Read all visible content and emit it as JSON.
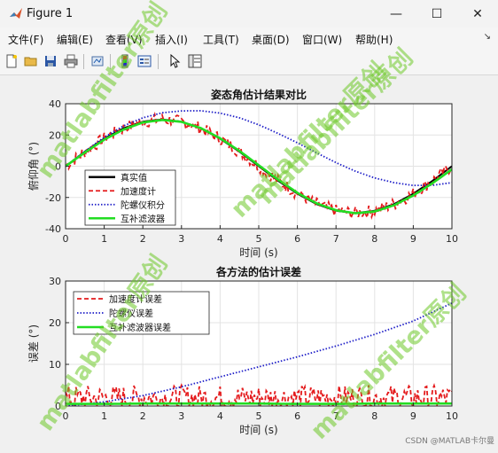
{
  "window": {
    "title": "Figure 1",
    "controls": {
      "minimize": "—",
      "maximize": "☐",
      "close": "✕"
    }
  },
  "menu": [
    "文件(F)",
    "编辑(E)",
    "查看(V)",
    "插入(I)",
    "工具(T)",
    "桌面(D)",
    "窗口(W)",
    "帮助(H)"
  ],
  "menu_arrow": "↘",
  "toolbar": [
    "new-file-icon",
    "open-folder-icon",
    "save-icon",
    "print-icon",
    "link-plot-icon",
    "insert-colorbar-icon",
    "insert-legend-icon",
    "edit-plot-cursor-icon",
    "property-inspector-icon"
  ],
  "colors": {
    "true": "#000000",
    "accel": "#e41a1c",
    "gyro": "#1f1fc8",
    "comp": "#22dd22"
  },
  "chart_data": [
    {
      "type": "line",
      "title": "姿态角估计结果对比",
      "xlabel": "时间 (s)",
      "ylabel": "俯仰角 (°)",
      "xlim": [
        0,
        10
      ],
      "ylim": [
        -40,
        40
      ],
      "xticks": [
        0,
        1,
        2,
        3,
        4,
        5,
        6,
        7,
        8,
        9,
        10
      ],
      "yticks": [
        -40,
        -20,
        0,
        20,
        40
      ],
      "grid": true,
      "legend": "bottom-left",
      "x": [
        0,
        0.5,
        1,
        1.5,
        2,
        2.5,
        3,
        3.5,
        4,
        4.5,
        5,
        5.5,
        6,
        6.5,
        7,
        7.5,
        8,
        8.5,
        9,
        9.5,
        10
      ],
      "series": [
        {
          "name": "真实值",
          "style": "solid",
          "values": [
            0,
            9.3,
            17.7,
            24.3,
            28.5,
            30,
            28.5,
            24.3,
            17.6,
            9.3,
            0,
            -9.3,
            -17.6,
            -24.3,
            -28.5,
            -30,
            -28.5,
            -24.3,
            -17.6,
            -9.3,
            0
          ]
        },
        {
          "name": "加速度计",
          "style": "dashed",
          "noisy": true,
          "noise": 4,
          "values": [
            0,
            9.3,
            17.7,
            24.3,
            28.5,
            30,
            28.5,
            24.3,
            17.6,
            9.3,
            0,
            -9.3,
            -17.6,
            -24.3,
            -28.5,
            -30,
            -28.5,
            -24.3,
            -17.6,
            -9.3,
            0
          ]
        },
        {
          "name": "陀螺仪积分",
          "style": "dotted",
          "values": [
            0,
            9.6,
            18.5,
            25.8,
            31,
            34.2,
            35.4,
            35.5,
            34,
            31,
            26.5,
            21,
            15,
            8.5,
            2.3,
            -3.2,
            -7.5,
            -10.5,
            -12.3,
            -12.2,
            -10.5
          ]
        },
        {
          "name": "互补滤波器",
          "style": "solid",
          "values": [
            0,
            8.8,
            17,
            23.5,
            28,
            29.6,
            28.4,
            24.4,
            17.9,
            9.8,
            0.6,
            -8.6,
            -17,
            -23.8,
            -28.2,
            -30.1,
            -29,
            -25,
            -18.7,
            -10.8,
            -2
          ]
        }
      ]
    },
    {
      "type": "line",
      "title": "各方法的估计误差",
      "xlabel": "时间 (s)",
      "ylabel": "误差 (°)",
      "xlim": [
        0,
        10
      ],
      "ylim": [
        0,
        30
      ],
      "xticks": [
        0,
        1,
        2,
        3,
        4,
        5,
        6,
        7,
        8,
        9,
        10
      ],
      "yticks": [
        0,
        10,
        20,
        30
      ],
      "grid": true,
      "legend": "top-left",
      "x": [
        0,
        1,
        2,
        3,
        4,
        5,
        6,
        7,
        8,
        9,
        10
      ],
      "series": [
        {
          "name": "加速度计误差",
          "style": "dashed",
          "noisy": true,
          "noise": 3,
          "values": [
            2,
            2,
            2,
            2,
            2,
            2,
            2,
            2,
            2,
            2,
            2
          ]
        },
        {
          "name": "陀螺仪误差",
          "style": "dotted",
          "values": [
            0,
            1,
            2.5,
            4.6,
            7,
            9.4,
            11.8,
            14.4,
            17.2,
            20.4,
            24.7
          ]
        },
        {
          "name": "互补滤波器误差",
          "style": "solid",
          "values": [
            0.5,
            0.5,
            0.6,
            0.6,
            0.6,
            0.6,
            0.5,
            0.5,
            0.6,
            0.6,
            0.6
          ]
        }
      ]
    }
  ],
  "watermarks": [
    "matlabfilter原创",
    "matlabfilter原创",
    "matlabfilter原创",
    "matlabfilter原创",
    "matlabfilter原创"
  ],
  "credit": "CSDN @MATLAB卡尔曼"
}
